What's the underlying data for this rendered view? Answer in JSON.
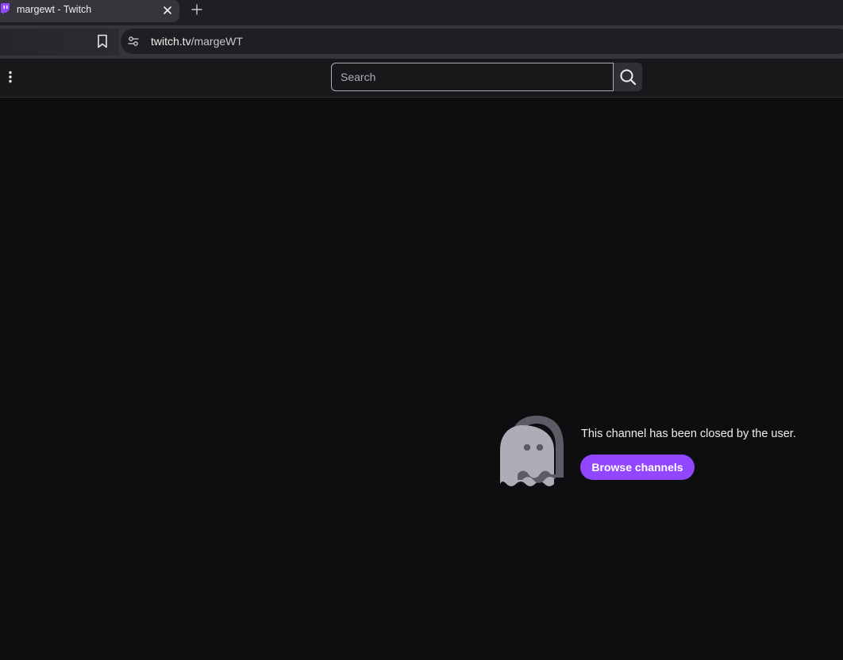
{
  "browser": {
    "tab": {
      "title": "margewt - Twitch",
      "favicon": "twitch-icon"
    },
    "address_bar": {
      "host": "twitch.tv",
      "path": "/margeWT"
    }
  },
  "topnav": {
    "search": {
      "placeholder": "Search"
    }
  },
  "main": {
    "message": "This channel has been closed by the user.",
    "browse_button": "Browse channels",
    "illustration": "ghost-icon"
  },
  "colors": {
    "accent": "#9147ff",
    "background": "#0e0e10",
    "nav": "#18181b"
  }
}
